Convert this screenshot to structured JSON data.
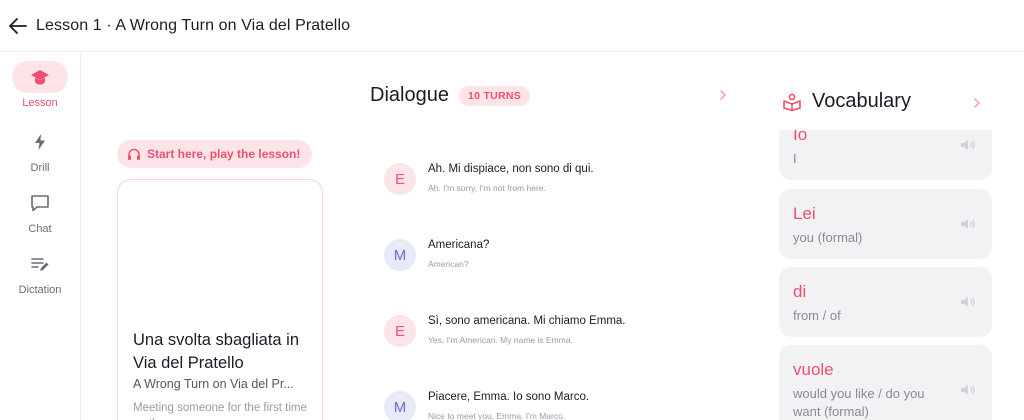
{
  "header": {
    "title": "Lesson 1 · A Wrong Turn on Via del Pratello"
  },
  "nav": {
    "items": [
      {
        "label": "Lesson",
        "icon": "graduation-cap-icon",
        "active": true
      },
      {
        "label": "Drill",
        "icon": "lightning-icon",
        "active": false
      },
      {
        "label": "Chat",
        "icon": "chat-bubble-icon",
        "active": false
      },
      {
        "label": "Dictation",
        "icon": "dictation-icon",
        "active": false
      }
    ]
  },
  "lesson": {
    "start_label": "Start here, play the lesson!",
    "card_title": "Una svolta sbagliata in Via del Pratello",
    "card_subtitle": "A Wrong Turn on Via del Pr...",
    "card_description": "Meeting someone for the first time on the..."
  },
  "dialogue": {
    "title": "Dialogue",
    "turns_badge": "10 TURNS",
    "turns": [
      {
        "speaker": "E",
        "italian": "Ah. Mi dispiace, non sono di qui.",
        "english": "Ah. I'm sorry, I'm not from here."
      },
      {
        "speaker": "M",
        "italian": "Americana?",
        "english": "American?"
      },
      {
        "speaker": "E",
        "italian": "Sì, sono americana. Mi chiamo Emma.",
        "english": "Yes, I'm American. My name is Emma."
      },
      {
        "speaker": "M",
        "italian": "Piacere, Emma. Io sono Marco.",
        "english": "Nice to meet you, Emma. I'm Marco."
      }
    ]
  },
  "vocabulary": {
    "title": "Vocabulary",
    "items": [
      {
        "word": "Io",
        "definition": "I"
      },
      {
        "word": "Lei",
        "definition": "you (formal)"
      },
      {
        "word": "di",
        "definition": "from / of"
      },
      {
        "word": "vuole",
        "definition": "would you like / do you want (formal)"
      }
    ]
  },
  "colors": {
    "accent": "#f0506e",
    "accent_soft": "#fde4e8",
    "speaker_m": "#6b6fd6"
  }
}
